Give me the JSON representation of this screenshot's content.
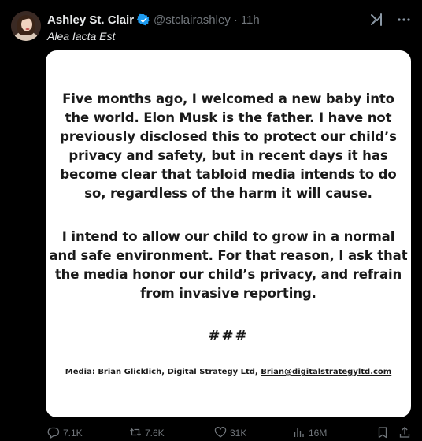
{
  "author": {
    "display_name": "Ashley St. Clair",
    "handle": "@stclairashley",
    "separator": "·",
    "timestamp": "11h",
    "verified_color": "#1d9bf0"
  },
  "tweet": {
    "text": "Alea Iacta Est"
  },
  "statement": {
    "paragraph1_lines": [
      "Five months ago, I welcomed a new baby into",
      "the world. Elon Musk is the father. I have not",
      "previously disclosed this to protect our child’s",
      "privacy and safety, but in recent days it has",
      "become clear that tabloid media intends to do",
      "so, regardless of the harm it will cause."
    ],
    "paragraph2_lines": [
      "I intend to allow our child to grow in a normal",
      "and safe environment. For that reason, I ask that",
      "the media honor our child’s privacy, and refrain",
      "from invasive reporting."
    ],
    "separator": "###",
    "contact_prefix": "Media: Brian Glicklich, Digital Strategy Ltd, ",
    "contact_email": "Brian@digitalstrategyltd.com"
  },
  "actions": {
    "replies": "7.1K",
    "reposts": "7.6K",
    "likes": "31K",
    "views": "16M"
  },
  "icons": [
    "verified-badge-icon",
    "grok-icon",
    "more-icon",
    "reply-icon",
    "repost-icon",
    "like-icon",
    "views-icon",
    "bookmark-icon",
    "share-icon"
  ]
}
